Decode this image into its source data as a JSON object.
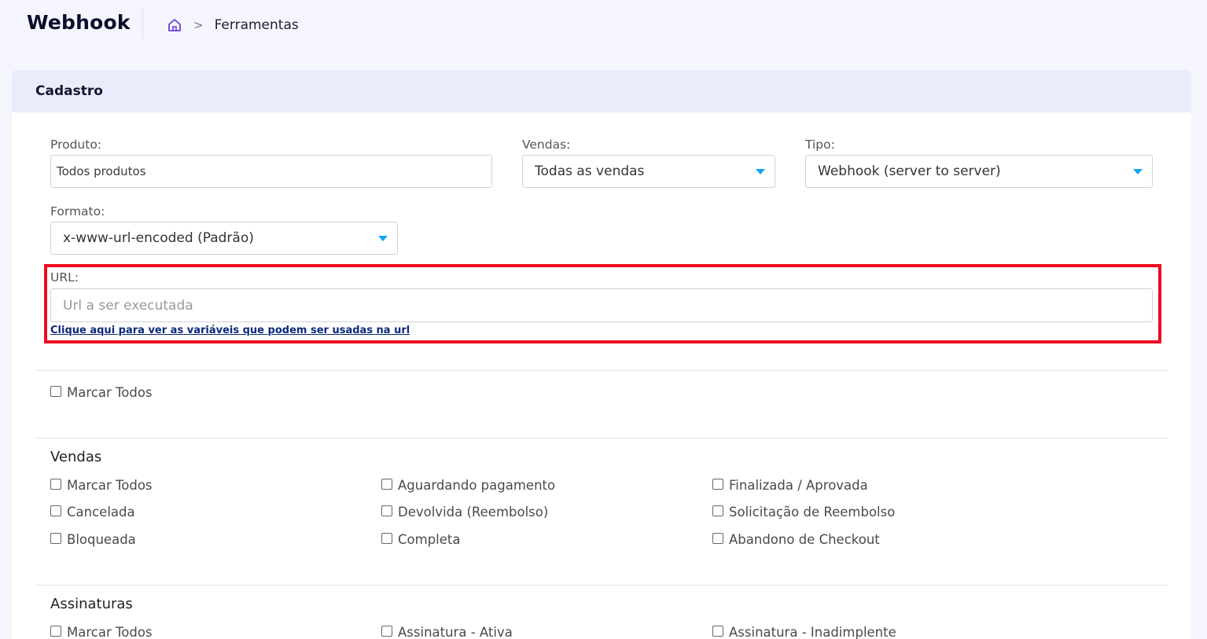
{
  "header": {
    "title": "Webhook",
    "breadcrumb_separator": ">",
    "breadcrumb_current": "Ferramentas"
  },
  "card": {
    "title": "Cadastro"
  },
  "form": {
    "produto": {
      "label": "Produto:",
      "value": "Todos produtos"
    },
    "vendas": {
      "label": "Vendas:",
      "value": "Todas as vendas"
    },
    "tipo": {
      "label": "Tipo:",
      "value": "Webhook (server to server)"
    },
    "formato": {
      "label": "Formato:",
      "value": "x-www-url-encoded (Padrão)"
    },
    "url": {
      "label": "URL:",
      "placeholder": "Url a ser executada",
      "help_link": "Clique aqui para ver as variáveis que podem ser usadas na url"
    }
  },
  "global_check": {
    "label": "Marcar Todos",
    "checked": false
  },
  "sections": {
    "vendas": {
      "title": "Vendas",
      "items": [
        "Marcar Todos",
        "Aguardando pagamento",
        "Finalizada / Aprovada",
        "Cancelada",
        "Devolvida (Reembolso)",
        "Solicitação de Reembolso",
        "Bloqueada",
        "Completa",
        "Abandono de Checkout"
      ]
    },
    "assinaturas": {
      "title": "Assinaturas",
      "items": [
        "Marcar Todos",
        "Assinatura - Ativa",
        "Assinatura - Inadimplente"
      ]
    }
  },
  "colors": {
    "accent_caret": "#0ea5f0",
    "highlight_border": "#ef0a1f",
    "header_bg": "#ebecfb",
    "page_bg": "#f5f6fd",
    "home_icon": "#6b3fd4"
  },
  "icons": {
    "home": "home-icon",
    "dropdown": "caret-down-icon"
  }
}
